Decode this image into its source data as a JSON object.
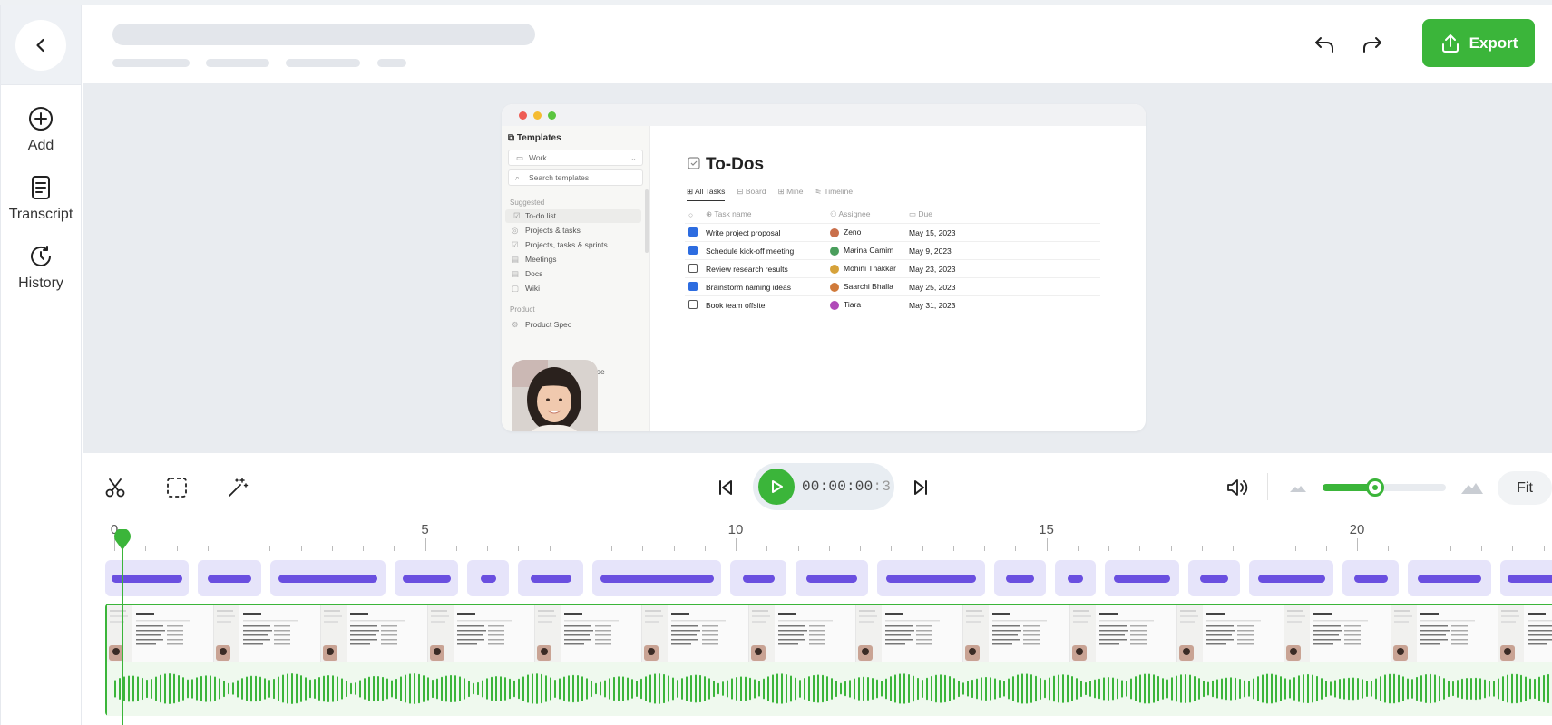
{
  "colors": {
    "accent": "#3bb53a",
    "segment": "#6a4fe0",
    "segment_bg": "#e6e4fa"
  },
  "rail": {
    "back_icon": "chevron-left-icon",
    "items": [
      {
        "label": "Add",
        "icon": "plus-circle-icon"
      },
      {
        "label": "Transcript",
        "icon": "document-icon"
      },
      {
        "label": "History",
        "icon": "history-icon"
      }
    ]
  },
  "header": {
    "export_label": "Export",
    "undo_icon": "undo-icon",
    "redo_icon": "redo-icon"
  },
  "preview": {
    "sidebar": {
      "title": "Templates",
      "workspace": "Work",
      "search_placeholder": "Search templates",
      "suggested_label": "Suggested",
      "suggested_items": [
        "To-do list",
        "Projects & tasks",
        "Projects, tasks & sprints",
        "Meetings",
        "Docs",
        "Wiki"
      ],
      "product_label": "Product",
      "product_items": [
        "Product Spec"
      ],
      "partial_text": "ase"
    },
    "page_title": "To-Dos",
    "tabs": [
      "All Tasks",
      "Board",
      "Mine",
      "Timeline"
    ],
    "columns": [
      "Task name",
      "Assignee",
      "Due"
    ],
    "rows": [
      {
        "checked": true,
        "task": "Write project proposal",
        "assignee": "Zeno",
        "due": "May 15, 2023",
        "color": "#c96f4a"
      },
      {
        "checked": true,
        "task": "Schedule kick-off meeting",
        "assignee": "Marina Camim",
        "due": "May 9, 2023",
        "color": "#4a9e5c"
      },
      {
        "checked": false,
        "task": "Review research results",
        "assignee": "Mohini Thakkar",
        "due": "May 23, 2023",
        "color": "#d6a23a"
      },
      {
        "checked": true,
        "task": "Brainstorm naming ideas",
        "assignee": "Saarchi Bhalla",
        "due": "May 25, 2023",
        "color": "#d07a3a"
      },
      {
        "checked": false,
        "task": "Book team offsite",
        "assignee": "Tiara",
        "due": "May 31, 2023",
        "color": "#b04ab8"
      }
    ]
  },
  "controls": {
    "timecode_main": "00:00:00",
    "timecode_frac": ":3",
    "volume_level": 0.43,
    "fit_label": "Fit"
  },
  "timeline": {
    "ruler_labels": [
      "0",
      "5",
      "10",
      "15",
      "20"
    ],
    "segment_bar_fractions": [
      0.85,
      0.68,
      0.86,
      0.76,
      0.38,
      0.62,
      0.88,
      0.56,
      0.7,
      0.83,
      0.55,
      0.38,
      0.76,
      0.55,
      0.8,
      0.6,
      0.76,
      0.8
    ]
  }
}
